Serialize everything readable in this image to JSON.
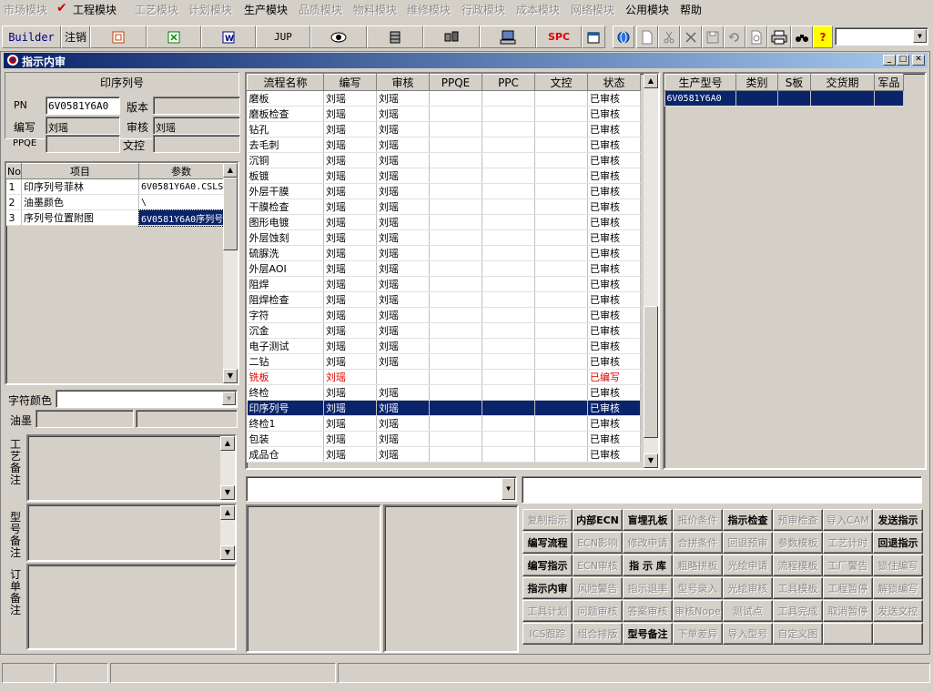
{
  "menu": [
    "市场模块",
    "工程模块",
    "工艺模块",
    "计划模块",
    "生产模块",
    "品质模块",
    "物料模块",
    "维修模块",
    "行政模块",
    "成本模块",
    "网络模块",
    "公用模块",
    "帮助"
  ],
  "toolbar": {
    "builder": "Builder",
    "logout": "注销",
    "jup": "JUP",
    "spc": "SPC",
    "help": "?"
  },
  "window": {
    "title": "指示内审"
  },
  "left": {
    "section_title": "印序列号",
    "pn_label": "PN",
    "pn_value": "6V0581Y6A0",
    "version_label": "版本",
    "version_value": "",
    "author_label": "编写",
    "author_value": "刘瑶",
    "review_label": "审核",
    "review_value": "刘瑶",
    "ppqe_label": "PPQE",
    "ppqe_value": "",
    "doc_label": "文控",
    "doc_value": "",
    "param_headers": [
      "No",
      "项目",
      "参数"
    ],
    "params": [
      {
        "no": "1",
        "item": "印序列号菲林",
        "value": "6V0581Y6A0.CSLS"
      },
      {
        "no": "2",
        "item": "油墨颜色",
        "value": "\\"
      },
      {
        "no": "3",
        "item": "序列号位置附图",
        "value": "6V0581Y6A0序列号"
      }
    ],
    "char_color_label": "字符颜色",
    "ink_label": "油墨",
    "process_note_label": "工艺备注",
    "model_note_label": "型号备注",
    "order_note_label": "订单备注"
  },
  "process": {
    "headers": [
      "流程名称",
      "编写",
      "审核",
      "PPQE",
      "PPC",
      "文控",
      "状态"
    ],
    "rows": [
      {
        "name": "磨板",
        "author": "刘瑶",
        "review": "刘瑶",
        "status": "已审核"
      },
      {
        "name": "磨板检查",
        "author": "刘瑶",
        "review": "刘瑶",
        "status": "已审核"
      },
      {
        "name": "钻孔",
        "author": "刘瑶",
        "review": "刘瑶",
        "status": "已审核"
      },
      {
        "name": "去毛刺",
        "author": "刘瑶",
        "review": "刘瑶",
        "status": "已审核"
      },
      {
        "name": "沉铜",
        "author": "刘瑶",
        "review": "刘瑶",
        "status": "已审核"
      },
      {
        "name": "板镀",
        "author": "刘瑶",
        "review": "刘瑶",
        "status": "已审核"
      },
      {
        "name": "外层干膜",
        "author": "刘瑶",
        "review": "刘瑶",
        "status": "已审核"
      },
      {
        "name": "干膜检查",
        "author": "刘瑶",
        "review": "刘瑶",
        "status": "已审核"
      },
      {
        "name": "图形电镀",
        "author": "刘瑶",
        "review": "刘瑶",
        "status": "已审核"
      },
      {
        "name": "外层蚀刻",
        "author": "刘瑶",
        "review": "刘瑶",
        "status": "已审核"
      },
      {
        "name": "硫脲洗",
        "author": "刘瑶",
        "review": "刘瑶",
        "status": "已审核"
      },
      {
        "name": "外层AOI",
        "author": "刘瑶",
        "review": "刘瑶",
        "status": "已审核"
      },
      {
        "name": "阻焊",
        "author": "刘瑶",
        "review": "刘瑶",
        "status": "已审核"
      },
      {
        "name": "阻焊检查",
        "author": "刘瑶",
        "review": "刘瑶",
        "status": "已审核"
      },
      {
        "name": "字符",
        "author": "刘瑶",
        "review": "刘瑶",
        "status": "已审核"
      },
      {
        "name": "沉金",
        "author": "刘瑶",
        "review": "刘瑶",
        "status": "已审核"
      },
      {
        "name": "电子测试",
        "author": "刘瑶",
        "review": "刘瑶",
        "status": "已审核"
      },
      {
        "name": "二钻",
        "author": "刘瑶",
        "review": "刘瑶",
        "status": "已审核"
      },
      {
        "name": "铣板",
        "author": "刘瑶",
        "review": "",
        "status": "已编写",
        "red": true
      },
      {
        "name": "终检",
        "author": "刘瑶",
        "review": "刘瑶",
        "status": "已审核"
      },
      {
        "name": "印序列号",
        "author": "刘瑶",
        "review": "刘瑶",
        "status": "已审核",
        "selected": true
      },
      {
        "name": "终检1",
        "author": "刘瑶",
        "review": "刘瑶",
        "status": "已审核"
      },
      {
        "name": "包装",
        "author": "刘瑶",
        "review": "刘瑶",
        "status": "已审核"
      },
      {
        "name": "成品仓",
        "author": "刘瑶",
        "review": "刘瑶",
        "status": "已审核"
      }
    ]
  },
  "production": {
    "headers": [
      "生产型号",
      "类别",
      "S板",
      "交货期",
      "军品"
    ],
    "rows": [
      {
        "model": "6V0581Y6A0",
        "type": "",
        "s": "",
        "due": "",
        "mil": ""
      }
    ]
  },
  "actions": [
    [
      "复制指示",
      "内部ECN",
      "盲埋孔板",
      "报价条件",
      "指示检查",
      "预审检查",
      "导入CAM",
      "发送指示"
    ],
    [
      "编写流程",
      "ECN影响",
      "修改申请",
      "合拼条件",
      "回退预审",
      "参数模板",
      "工艺计时",
      "回退指示"
    ],
    [
      "编写指示",
      "ECN审核",
      "指 示 库",
      "粗略拼板",
      "光绘申请",
      "流程模板",
      "工厂警告",
      "锁住编写"
    ],
    [
      "指示内审",
      "风险警告",
      "指示退率",
      "型号录入",
      "光绘审核",
      "工具模板",
      "工程暂停",
      "解锁编写"
    ],
    [
      "工具计划",
      "问题审核",
      "答案审核",
      "审核Nope",
      "测试点",
      "工具完成",
      "取消暂停",
      "发送文控"
    ],
    [
      "ICS跟踪",
      "组合排版",
      "型号备注",
      "下单差异",
      "导入型号",
      "自定义图",
      "",
      ""
    ]
  ],
  "actions_enabled": [
    [
      false,
      true,
      true,
      false,
      true,
      false,
      false,
      true
    ],
    [
      true,
      false,
      false,
      false,
      false,
      false,
      false,
      true
    ],
    [
      true,
      false,
      true,
      false,
      false,
      false,
      false,
      false
    ],
    [
      true,
      false,
      false,
      false,
      false,
      false,
      false,
      false
    ],
    [
      false,
      false,
      false,
      false,
      false,
      false,
      false,
      false
    ],
    [
      false,
      false,
      true,
      false,
      false,
      false,
      false,
      false
    ]
  ]
}
